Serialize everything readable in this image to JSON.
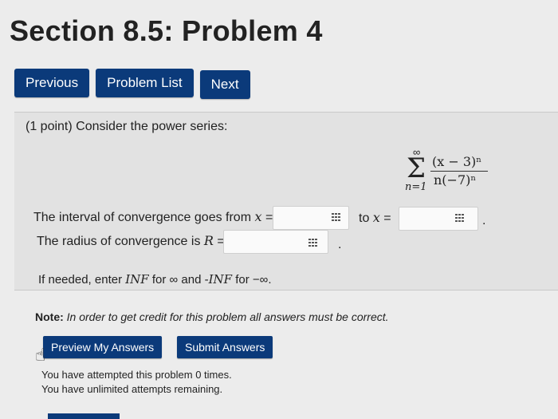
{
  "page": {
    "title": "Section 8.5: Problem 4"
  },
  "nav": {
    "previous": "Previous",
    "problem_list": "Problem List",
    "next": "Next"
  },
  "problem": {
    "intro": "(1 point) Consider the power series:",
    "series": {
      "upper": "∞",
      "sigma": "Σ",
      "lower": "n=1",
      "numerator": "(x − 3)ⁿ",
      "denominator": "n(−7)ⁿ"
    },
    "interval": {
      "label_before": "The interval of convergence goes from ",
      "var": "x",
      "eq": " = ",
      "to_label": "to ",
      "to_var": "x",
      "to_eq": " =",
      "value_from": "",
      "value_to": "",
      "trailing": "."
    },
    "radius": {
      "label_before": "The radius of convergence is ",
      "var": "R",
      "eq": " =",
      "value": "",
      "trailing": "."
    },
    "hint": {
      "part1": "If needed, enter ",
      "inf": "INF",
      "part2": " for ∞ and -",
      "inf2": "INF",
      "part3": " for −∞."
    }
  },
  "note": {
    "label": "Note:",
    "text": " In order to get credit for this problem all answers must be correct."
  },
  "actions": {
    "preview": "Preview My Answers",
    "submit": "Submit Answers"
  },
  "attempts": {
    "line1": "You have attempted this problem 0 times.",
    "line2": "You have unlimited attempts remaining."
  },
  "colors": {
    "button": "#0b3a7a",
    "background": "#ececec"
  }
}
